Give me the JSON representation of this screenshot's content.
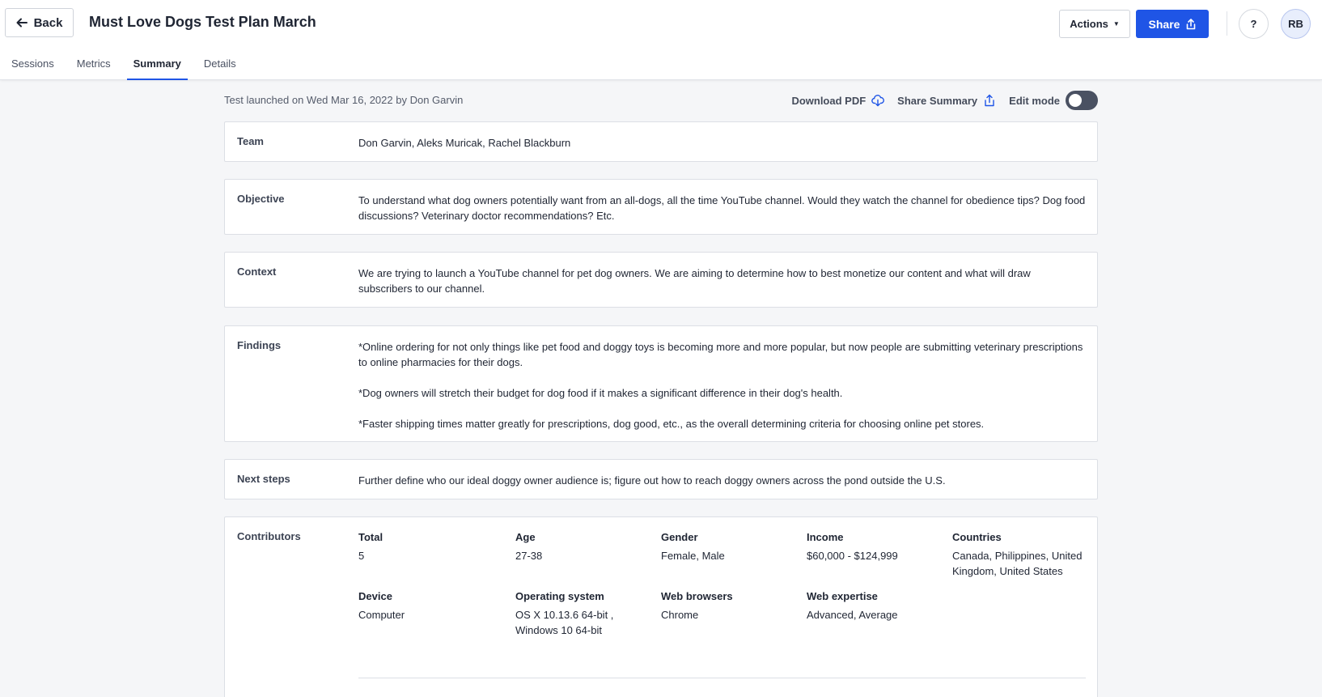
{
  "header": {
    "back_label": "Back",
    "title": "Must Love Dogs Test Plan March",
    "actions_label": "Actions",
    "share_label": "Share",
    "help_label": "?",
    "avatar_initials": "RB",
    "accent_color": "#1f55e6"
  },
  "tabs": [
    {
      "label": "Sessions"
    },
    {
      "label": "Metrics"
    },
    {
      "label": "Summary",
      "active": true
    },
    {
      "label": "Details"
    }
  ],
  "meta": {
    "launched_text": "Test launched on Wed Mar 16, 2022 by Don Garvin",
    "download_pdf_label": "Download PDF",
    "share_summary_label": "Share Summary",
    "edit_mode_label": "Edit mode",
    "edit_mode_on": false
  },
  "sections": {
    "team": {
      "label": "Team",
      "value": "Don Garvin, Aleks Muricak, Rachel Blackburn"
    },
    "objective": {
      "label": "Objective",
      "value": "To understand what dog owners potentially want from an all-dogs, all the time YouTube channel. Would they watch the channel for obedience tips? Dog food discussions? Veterinary doctor recommendations? Etc."
    },
    "context": {
      "label": "Context",
      "value": "We are trying to launch a YouTube channel for pet dog owners. We are aiming to determine how to best monetize our content and what will draw subscribers to our channel."
    },
    "findings": {
      "label": "Findings",
      "items": [
        "*Online ordering for not only things like pet food and doggy toys is becoming more and more popular, but now people are submitting veterinary prescriptions to online pharmacies for their dogs.",
        "*Dog owners will stretch their budget for dog food if it makes a significant difference in their dog's health.",
        "*Faster shipping times matter greatly for prescriptions, dog good, etc., as the overall determining criteria for choosing online pet stores."
      ]
    },
    "next_steps": {
      "label": "Next steps",
      "value": "Further define who our ideal doggy owner audience is; figure out how to reach doggy owners across the pond outside the U.S."
    },
    "contributors": {
      "label": "Contributors",
      "total_label": "Total",
      "total": "5",
      "age_label": "Age",
      "age": "27-38",
      "gender_label": "Gender",
      "gender": "Female, Male",
      "income_label": "Income",
      "income": "$60,000 - $124,999",
      "countries_label": "Countries",
      "countries": "Canada, Philippines, United Kingdom, United States",
      "device_label": "Device",
      "device": "Computer",
      "os_label": "Operating system",
      "os": "OS X 10.13.6 64-bit , Windows 10 64-bit",
      "browsers_label": "Web browsers",
      "browsers": "Chrome",
      "expertise_label": "Web expertise",
      "expertise": "Advanced, Average"
    }
  }
}
